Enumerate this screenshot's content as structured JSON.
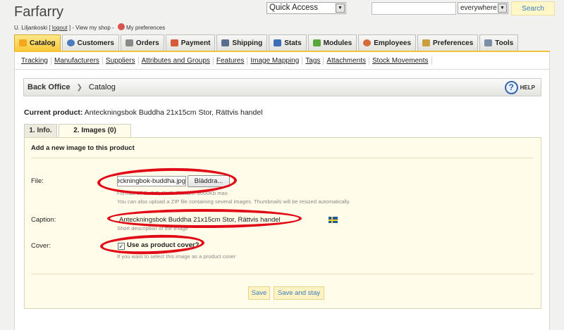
{
  "header": {
    "shop_title": "Farfarry",
    "user_name": "U. Liljankoski",
    "logout": "logout",
    "view_shop": "View my shop",
    "preferences": "My preferences",
    "quick_access": "Quick Access",
    "search_scope": "everywhere",
    "search_button": "Search"
  },
  "tabs": [
    {
      "label": "Catalog",
      "icon": "folder-icon",
      "color": "#f0a81e"
    },
    {
      "label": "Customers",
      "icon": "customer-icon",
      "color": "#4a7cc0"
    },
    {
      "label": "Orders",
      "icon": "cart-icon",
      "color": "#8a8a8a"
    },
    {
      "label": "Payment",
      "icon": "payment-icon",
      "color": "#d65a3a"
    },
    {
      "label": "Shipping",
      "icon": "truck-icon",
      "color": "#5a6f8f"
    },
    {
      "label": "Stats",
      "icon": "stats-icon",
      "color": "#3d6fb8"
    },
    {
      "label": "Modules",
      "icon": "puzzle-icon",
      "color": "#5aa83a"
    },
    {
      "label": "Employees",
      "icon": "employee-icon",
      "color": "#d66a3a"
    },
    {
      "label": "Preferences",
      "icon": "pencil-icon",
      "color": "#c8a040"
    },
    {
      "label": "Tools",
      "icon": "wrench-icon",
      "color": "#7a8ea8"
    }
  ],
  "subnav": [
    "Tracking",
    "Manufacturers",
    "Suppliers",
    "Attributes and Groups",
    "Features",
    "Image Mapping",
    "Tags",
    "Attachments",
    "Stock Movements"
  ],
  "breadcrumb": {
    "root": "Back Office",
    "current": "Catalog",
    "help": "HELP"
  },
  "product": {
    "prefix": "Current product:",
    "name": "Anteckningsbok Buddha 21x15cm Stor, Rättvis handel"
  },
  "product_tabs": {
    "info": "1. Info.",
    "images": "2. Images (0)"
  },
  "form": {
    "heading": "Add a new image to this product",
    "file_label": "File:",
    "file_value": "anteckningbok-buddha.jpg",
    "browse_button": "Bläddra...",
    "file_hint_1": "Format: JPG, GIF, PNG. Filesize: 8000Kb max.",
    "file_hint_2": "You can also upload a ZIP file containing several images. Thumbnails will be resized automatically.",
    "caption_label": "Caption:",
    "caption_value": "Anteckningsbok Buddha 21x15cm Stor, Rättvis handel",
    "caption_hint": "Short description of the image",
    "cover_label": "Cover:",
    "cover_checkbox_label": "Use as product cover?",
    "cover_checked": true,
    "cover_hint": "If you want to select this image as a product cover",
    "save_button": "Save",
    "save_stay_button": "Save and stay"
  },
  "annotation_color": "#e10a17"
}
